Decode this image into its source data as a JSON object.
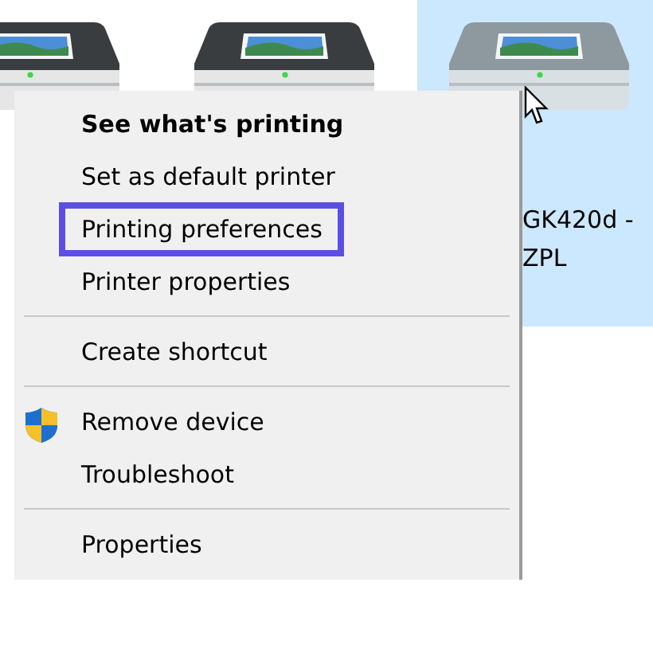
{
  "printers": [
    {
      "selected": false
    },
    {
      "selected": false
    },
    {
      "selected": true,
      "label": "GK420d - ZPL"
    }
  ],
  "context_menu": {
    "items": [
      {
        "kind": "item",
        "label": "See what's printing",
        "default": true,
        "highlighted": false
      },
      {
        "kind": "item",
        "label": "Set as default printer",
        "default": false,
        "highlighted": false
      },
      {
        "kind": "item",
        "label": "Printing preferences",
        "default": false,
        "highlighted": true
      },
      {
        "kind": "item",
        "label": "Printer properties",
        "default": false,
        "highlighted": false
      },
      {
        "kind": "separator"
      },
      {
        "kind": "item",
        "label": "Create shortcut",
        "default": false,
        "highlighted": false
      },
      {
        "kind": "separator"
      },
      {
        "kind": "elevated_item",
        "label": "Remove device",
        "default": false,
        "highlighted": false
      },
      {
        "kind": "item",
        "label": "Troubleshoot",
        "default": false,
        "highlighted": false
      },
      {
        "kind": "separator"
      },
      {
        "kind": "item",
        "label": "Properties",
        "default": false,
        "highlighted": false
      }
    ]
  }
}
